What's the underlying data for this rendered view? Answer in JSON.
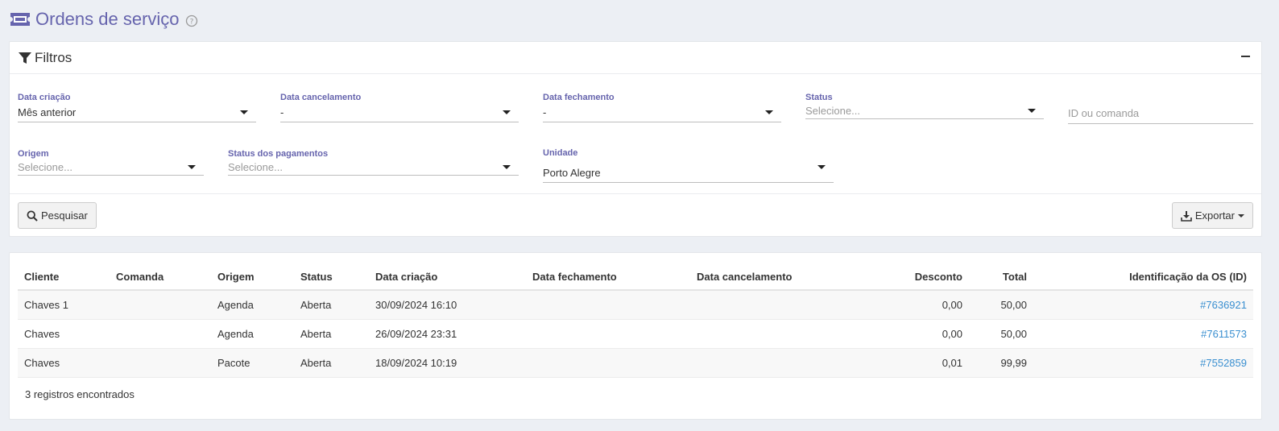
{
  "page": {
    "title": "Ordens de serviço"
  },
  "filters": {
    "title": "Filtros",
    "data_criacao": {
      "label": "Data criação",
      "value": "Mês anterior"
    },
    "data_cancelamento": {
      "label": "Data cancelamento",
      "value": "-"
    },
    "data_fechamento": {
      "label": "Data fechamento",
      "value": "-"
    },
    "status": {
      "label": "Status",
      "placeholder": "Selecione..."
    },
    "id_comanda": {
      "placeholder": "ID ou comanda"
    },
    "origem": {
      "label": "Origem",
      "placeholder": "Selecione..."
    },
    "status_pagamentos": {
      "label": "Status dos pagamentos",
      "placeholder": "Selecione..."
    },
    "unidade": {
      "label": "Unidade",
      "value": "Porto Alegre"
    },
    "search_label": "Pesquisar",
    "export_label": "Exportar"
  },
  "table": {
    "headers": [
      "Cliente",
      "Comanda",
      "Origem",
      "Status",
      "Data criação",
      "Data fechamento",
      "Data cancelamento",
      "Desconto",
      "Total",
      "Identificação da OS (ID)"
    ],
    "rows": [
      {
        "cliente": "Chaves 1",
        "comanda": "",
        "origem": "Agenda",
        "status": "Aberta",
        "data_criacao": "30/09/2024 16:10",
        "data_fechamento": "",
        "data_cancelamento": "",
        "desconto": "0,00",
        "total": "50,00",
        "id": "#7636921"
      },
      {
        "cliente": "Chaves",
        "comanda": "",
        "origem": "Agenda",
        "status": "Aberta",
        "data_criacao": "26/09/2024 23:31",
        "data_fechamento": "",
        "data_cancelamento": "",
        "desconto": "0,00",
        "total": "50,00",
        "id": "#7611573"
      },
      {
        "cliente": "Chaves",
        "comanda": "",
        "origem": "Pacote",
        "status": "Aberta",
        "data_criacao": "18/09/2024 10:19",
        "data_fechamento": "",
        "data_cancelamento": "",
        "desconto": "0,01",
        "total": "99,99",
        "id": "#7552859"
      }
    ],
    "count_text": "3 registros encontrados"
  },
  "colors": {
    "accent": "#6664ad",
    "link": "#3a8fd0",
    "background": "#eceff4"
  }
}
